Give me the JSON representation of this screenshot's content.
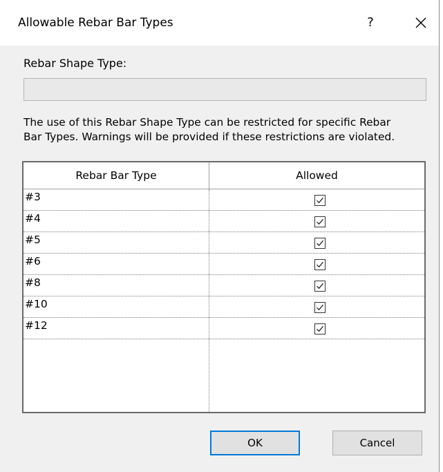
{
  "window": {
    "title": "Allowable Rebar Bar Types",
    "help_label": "?"
  },
  "shape_type": {
    "label": "Rebar Shape Type:",
    "value": ""
  },
  "description": {
    "line1": "The use of this Rebar Shape Type can be restricted for specific Rebar",
    "line2": "Bar Types.  Warnings will be provided if these restrictions are violated."
  },
  "table": {
    "columns": [
      "Rebar Bar Type",
      "Allowed"
    ],
    "rows": [
      {
        "bar_type": "#3",
        "allowed": true
      },
      {
        "bar_type": "#4",
        "allowed": true
      },
      {
        "bar_type": "#5",
        "allowed": true
      },
      {
        "bar_type": "#6",
        "allowed": true
      },
      {
        "bar_type": "#8",
        "allowed": true
      },
      {
        "bar_type": "#10",
        "allowed": true
      },
      {
        "bar_type": "#12",
        "allowed": true
      }
    ]
  },
  "buttons": {
    "ok": "OK",
    "cancel": "Cancel"
  },
  "colors": {
    "accent": "#0078d7",
    "dialog_bg": "#f0f0f0"
  },
  "icons": {
    "close": "close-icon",
    "checkbox": "checkmark-icon"
  }
}
